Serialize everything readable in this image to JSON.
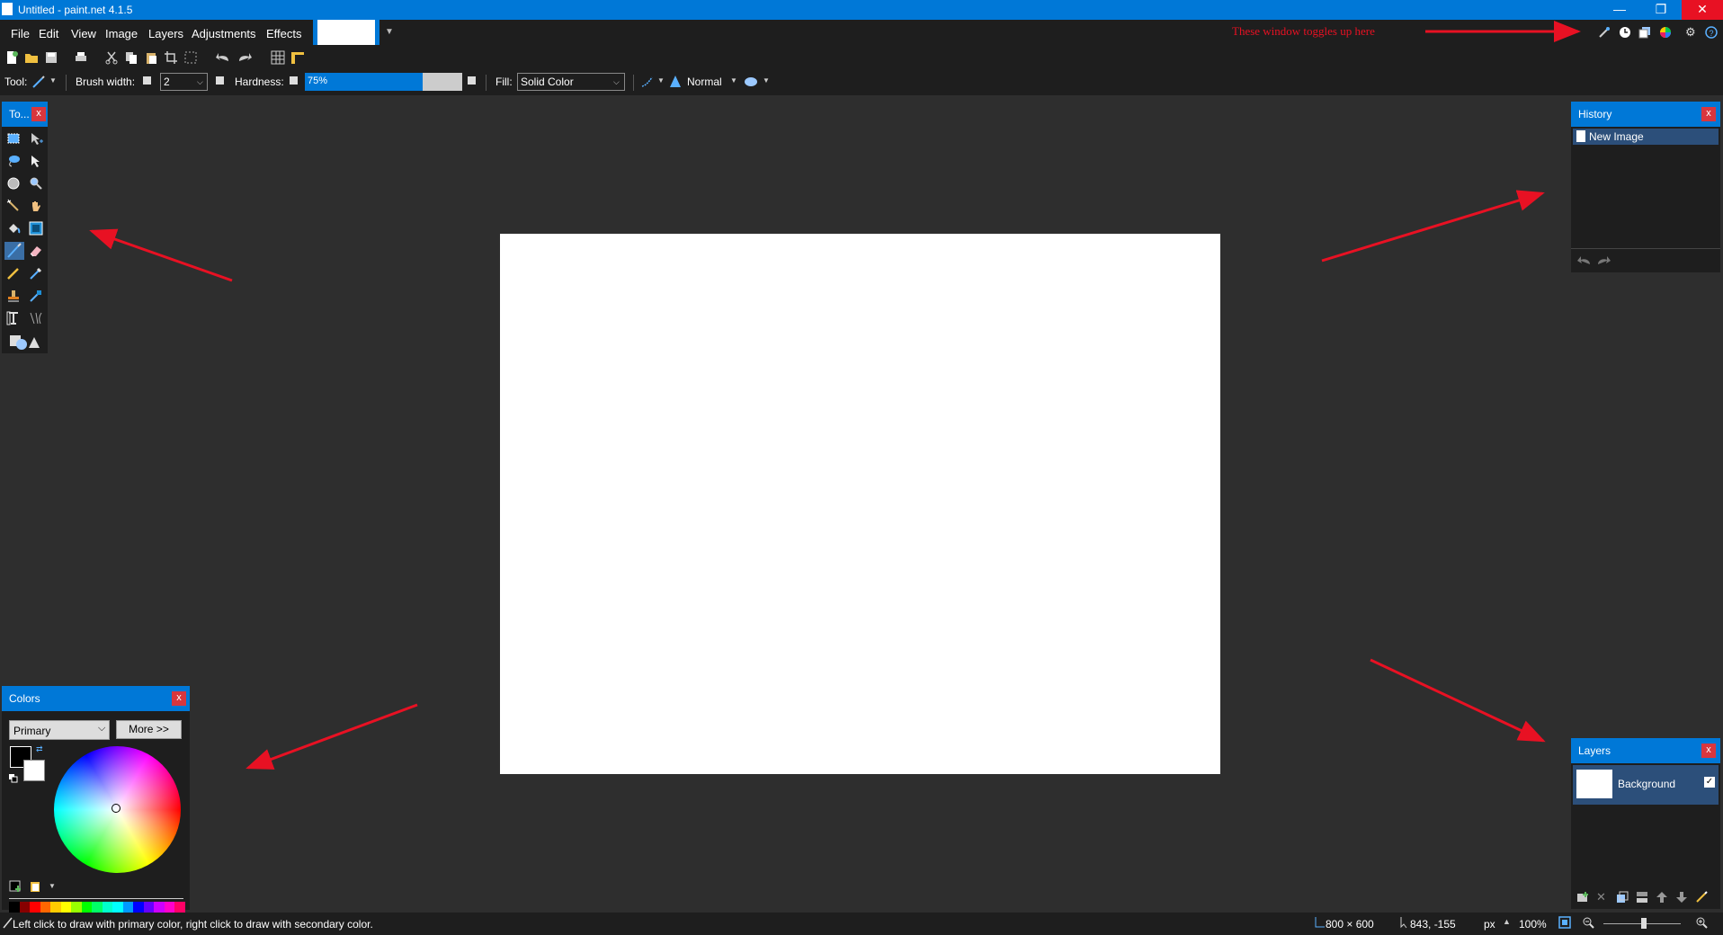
{
  "window": {
    "title": "Untitled - paint.net 4.1.5",
    "minimize": "—",
    "restore": "❐",
    "close": "✕"
  },
  "menu": [
    "File",
    "Edit",
    "View",
    "Image",
    "Layers",
    "Adjustments",
    "Effects"
  ],
  "annotation_text": "These window toggles up here",
  "toolbar2": {
    "tool_label": "Tool:",
    "brush_width_label": "Brush width:",
    "brush_width_value": "2",
    "hardness_label": "Hardness:",
    "hardness_value": "75%",
    "hardness_fraction": 0.75,
    "fill_label": "Fill:",
    "fill_value": "Solid Color",
    "blend_mode": "Normal"
  },
  "tools_panel": {
    "title": "To..."
  },
  "history_panel": {
    "title": "History",
    "items": [
      "New Image"
    ]
  },
  "layers_panel": {
    "title": "Layers",
    "items": [
      {
        "name": "Background",
        "visible": true
      }
    ]
  },
  "colors_panel": {
    "title": "Colors",
    "selector_value": "Primary",
    "more_label": "More >>",
    "primary_color": "#000000",
    "secondary_color": "#ffffff"
  },
  "status": {
    "hint": "Left click to draw with primary color, right click to draw with secondary color.",
    "image_size": "800 × 600",
    "cursor_pos": "843, -155",
    "units": "px",
    "zoom": "100%"
  },
  "colors": {
    "accent": "#0078d7",
    "close_red": "#e81123",
    "annotation_arrow": "#e81123"
  }
}
